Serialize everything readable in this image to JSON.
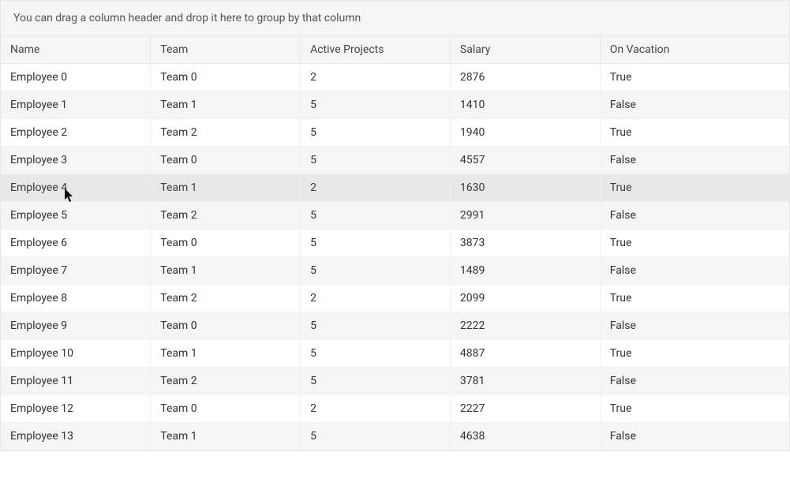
{
  "groupPanel": {
    "hint": "You can drag a column header and drop it here to group by that column"
  },
  "columns": [
    {
      "key": "name",
      "label": "Name"
    },
    {
      "key": "team",
      "label": "Team"
    },
    {
      "key": "proj",
      "label": "Active Projects"
    },
    {
      "key": "salary",
      "label": "Salary"
    },
    {
      "key": "vac",
      "label": "On Vacation"
    }
  ],
  "hoverRow": 4,
  "rows": [
    {
      "name": "Employee 0",
      "team": "Team 0",
      "proj": "2",
      "salary": "2876",
      "vac": "True"
    },
    {
      "name": "Employee 1",
      "team": "Team 1",
      "proj": "5",
      "salary": "1410",
      "vac": "False"
    },
    {
      "name": "Employee 2",
      "team": "Team 2",
      "proj": "5",
      "salary": "1940",
      "vac": "True"
    },
    {
      "name": "Employee 3",
      "team": "Team 0",
      "proj": "5",
      "salary": "4557",
      "vac": "False"
    },
    {
      "name": "Employee 4",
      "team": "Team 1",
      "proj": "2",
      "salary": "1630",
      "vac": "True"
    },
    {
      "name": "Employee 5",
      "team": "Team 2",
      "proj": "5",
      "salary": "2991",
      "vac": "False"
    },
    {
      "name": "Employee 6",
      "team": "Team 0",
      "proj": "5",
      "salary": "3873",
      "vac": "True"
    },
    {
      "name": "Employee 7",
      "team": "Team 1",
      "proj": "5",
      "salary": "1489",
      "vac": "False"
    },
    {
      "name": "Employee 8",
      "team": "Team 2",
      "proj": "2",
      "salary": "2099",
      "vac": "True"
    },
    {
      "name": "Employee 9",
      "team": "Team 0",
      "proj": "5",
      "salary": "2222",
      "vac": "False"
    },
    {
      "name": "Employee 10",
      "team": "Team 1",
      "proj": "5",
      "salary": "4887",
      "vac": "True"
    },
    {
      "name": "Employee 11",
      "team": "Team 2",
      "proj": "5",
      "salary": "3781",
      "vac": "False"
    },
    {
      "name": "Employee 12",
      "team": "Team 0",
      "proj": "2",
      "salary": "2227",
      "vac": "True"
    },
    {
      "name": "Employee 13",
      "team": "Team 1",
      "proj": "5",
      "salary": "4638",
      "vac": "False"
    }
  ]
}
